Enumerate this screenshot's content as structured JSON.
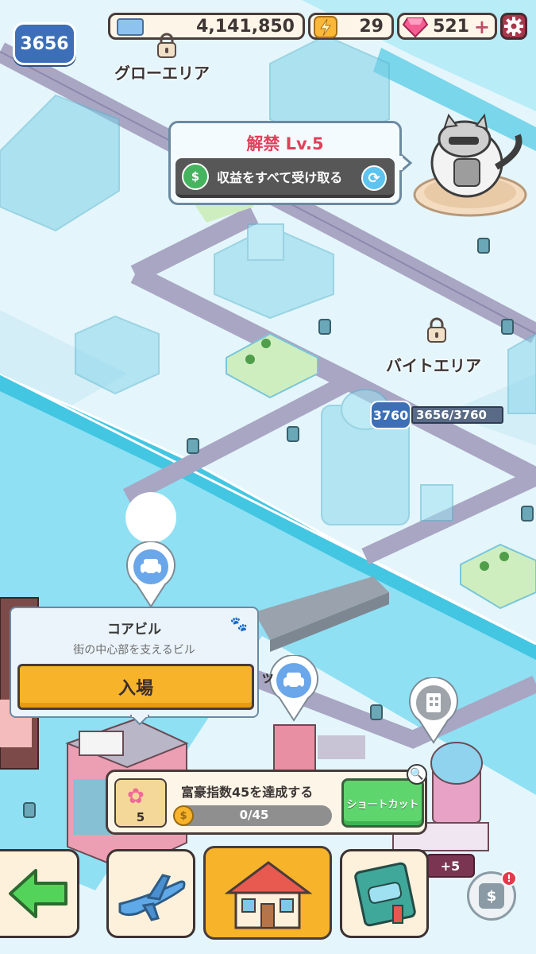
{
  "hud": {
    "level": "3656",
    "coins": "4,141,850",
    "energy": "29",
    "gems": "521"
  },
  "map": {
    "area_glow": "グローエリア",
    "area_bite": "バイトエリア",
    "district_level": "3760",
    "district_progress": "3656/3760",
    "hidden_label": "ッ"
  },
  "unlock_popup": {
    "title": "解禁 Lv.5",
    "collect_button": "収益をすべて受け取る"
  },
  "building_popup": {
    "name": "コアビル",
    "description": "街の中心部を支えるビル",
    "enter_button": "入場"
  },
  "mission": {
    "reward_count": "5",
    "title": "富豪指数45を達成する",
    "progress_text": "0/45",
    "progress": 0.0,
    "shortcut_button": "ショートカット"
  },
  "side_badge": "+5",
  "colors": {
    "accent_red": "#e0415b",
    "enter_yellow": "#f7b42a",
    "shortcut_green": "#5fd56e",
    "badge_blue": "#3d6fb8"
  }
}
